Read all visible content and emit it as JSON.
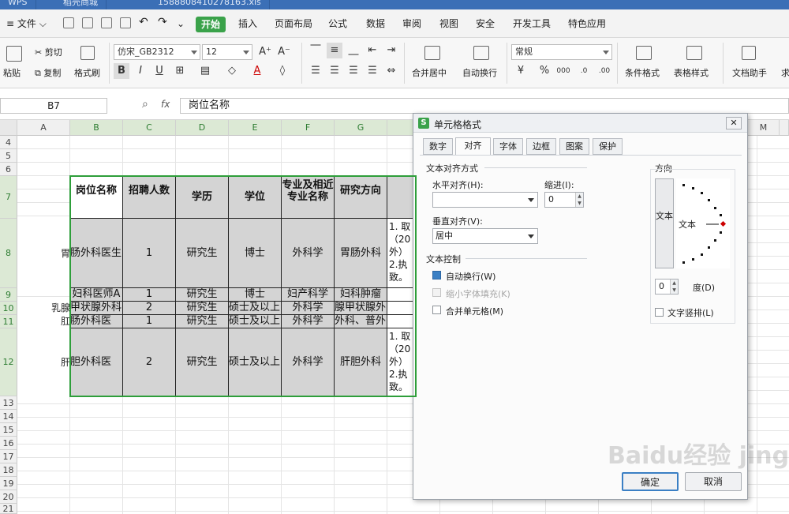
{
  "title_tabs": [
    "WPS",
    "稻壳商城",
    "1588808410278163.xls"
  ],
  "menu": {
    "file": "文件",
    "tabs": [
      "开始",
      "插入",
      "页面布局",
      "公式",
      "数据",
      "审阅",
      "视图",
      "安全",
      "开发工具",
      "特色应用"
    ]
  },
  "toolbar": {
    "paste": "粘贴",
    "cut": "剪切",
    "copy": "复制",
    "format_painter": "格式刷",
    "font_name": "仿宋_GB2312",
    "font_size": "12",
    "merge_center": "合并居中",
    "wrap": "自动换行",
    "number_format": "常规",
    "conditional_format": "条件格式",
    "table_style": "表格样式",
    "doc_assistant": "文档助手",
    "sum": "求"
  },
  "formula_bar": {
    "cell_ref": "B7",
    "fx": "fx",
    "content": "岗位名称"
  },
  "sheet": {
    "columns": [
      "A",
      "B",
      "C",
      "D",
      "E",
      "F",
      "G",
      "M"
    ],
    "rows": [
      "4",
      "5",
      "6",
      "7",
      "8",
      "9",
      "10",
      "11",
      "12",
      "13",
      "14",
      "15",
      "16",
      "17",
      "18",
      "19",
      "20",
      "21"
    ],
    "header_row": [
      "岗位名称",
      "招聘人数",
      "学历",
      "学位",
      "专业及相近专业名称",
      "研究方向"
    ],
    "data_rows": [
      {
        "a": "胃",
        "b": "肠外科医生",
        "c": "1",
        "d": "研究生",
        "e": "博士",
        "f": "外科学",
        "g": "胃肠外科",
        "h": "1. 取（20外）2.执致。"
      },
      {
        "a": "",
        "b": "妇科医师A",
        "c": "1",
        "d": "研究生",
        "e": "博士",
        "f": "妇产科学",
        "g": "妇科肿瘤",
        "h": ""
      },
      {
        "a": "乳腺",
        "b": "甲状腺外科",
        "c": "2",
        "d": "研究生",
        "e": "硕士及以上",
        "f": "外科学",
        "g": "腺甲状腺外科",
        "h": ""
      },
      {
        "a": "肛",
        "b": "肠外科医",
        "c": "1",
        "d": "研究生",
        "e": "硕士及以上",
        "f": "外科学",
        "g": "外科、普外科",
        "h": ""
      },
      {
        "a": "肝",
        "b": "胆外科医",
        "c": "2",
        "d": "研究生",
        "e": "硕士及以上",
        "f": "外科学",
        "g": "肝胆外科",
        "h": "1. 取（20外）2.执致。"
      }
    ]
  },
  "dialog": {
    "title": "单元格格式",
    "tabs": [
      "数字",
      "对齐",
      "字体",
      "边框",
      "图案",
      "保护"
    ],
    "text_align_group": "文本对齐方式",
    "horizontal_label": "水平对齐(H):",
    "horizontal_value": "",
    "indent_label": "缩进(I):",
    "indent_value": "0",
    "vertical_label": "垂直对齐(V):",
    "vertical_value": "居中",
    "text_control_group": "文本控制",
    "wrap_text": "自动换行(W)",
    "wrap_checked": true,
    "shrink_fit": "缩小字体填充(K)",
    "merge_cells": "合并单元格(M)",
    "orientation_group": "方向",
    "vertical_text": "文本",
    "orientation_text": "文本",
    "degree_value": "0",
    "degree_label": "度(D)",
    "vertical_arrange": "文字竖排(L)",
    "ok": "确定",
    "cancel": "取消"
  },
  "watermark": "Baidu经验 jingyan.baidu.com",
  "colors": {
    "accent": "#3aa24a",
    "selection": "#2e9e3a",
    "title_bar": "#3b6fb6"
  }
}
